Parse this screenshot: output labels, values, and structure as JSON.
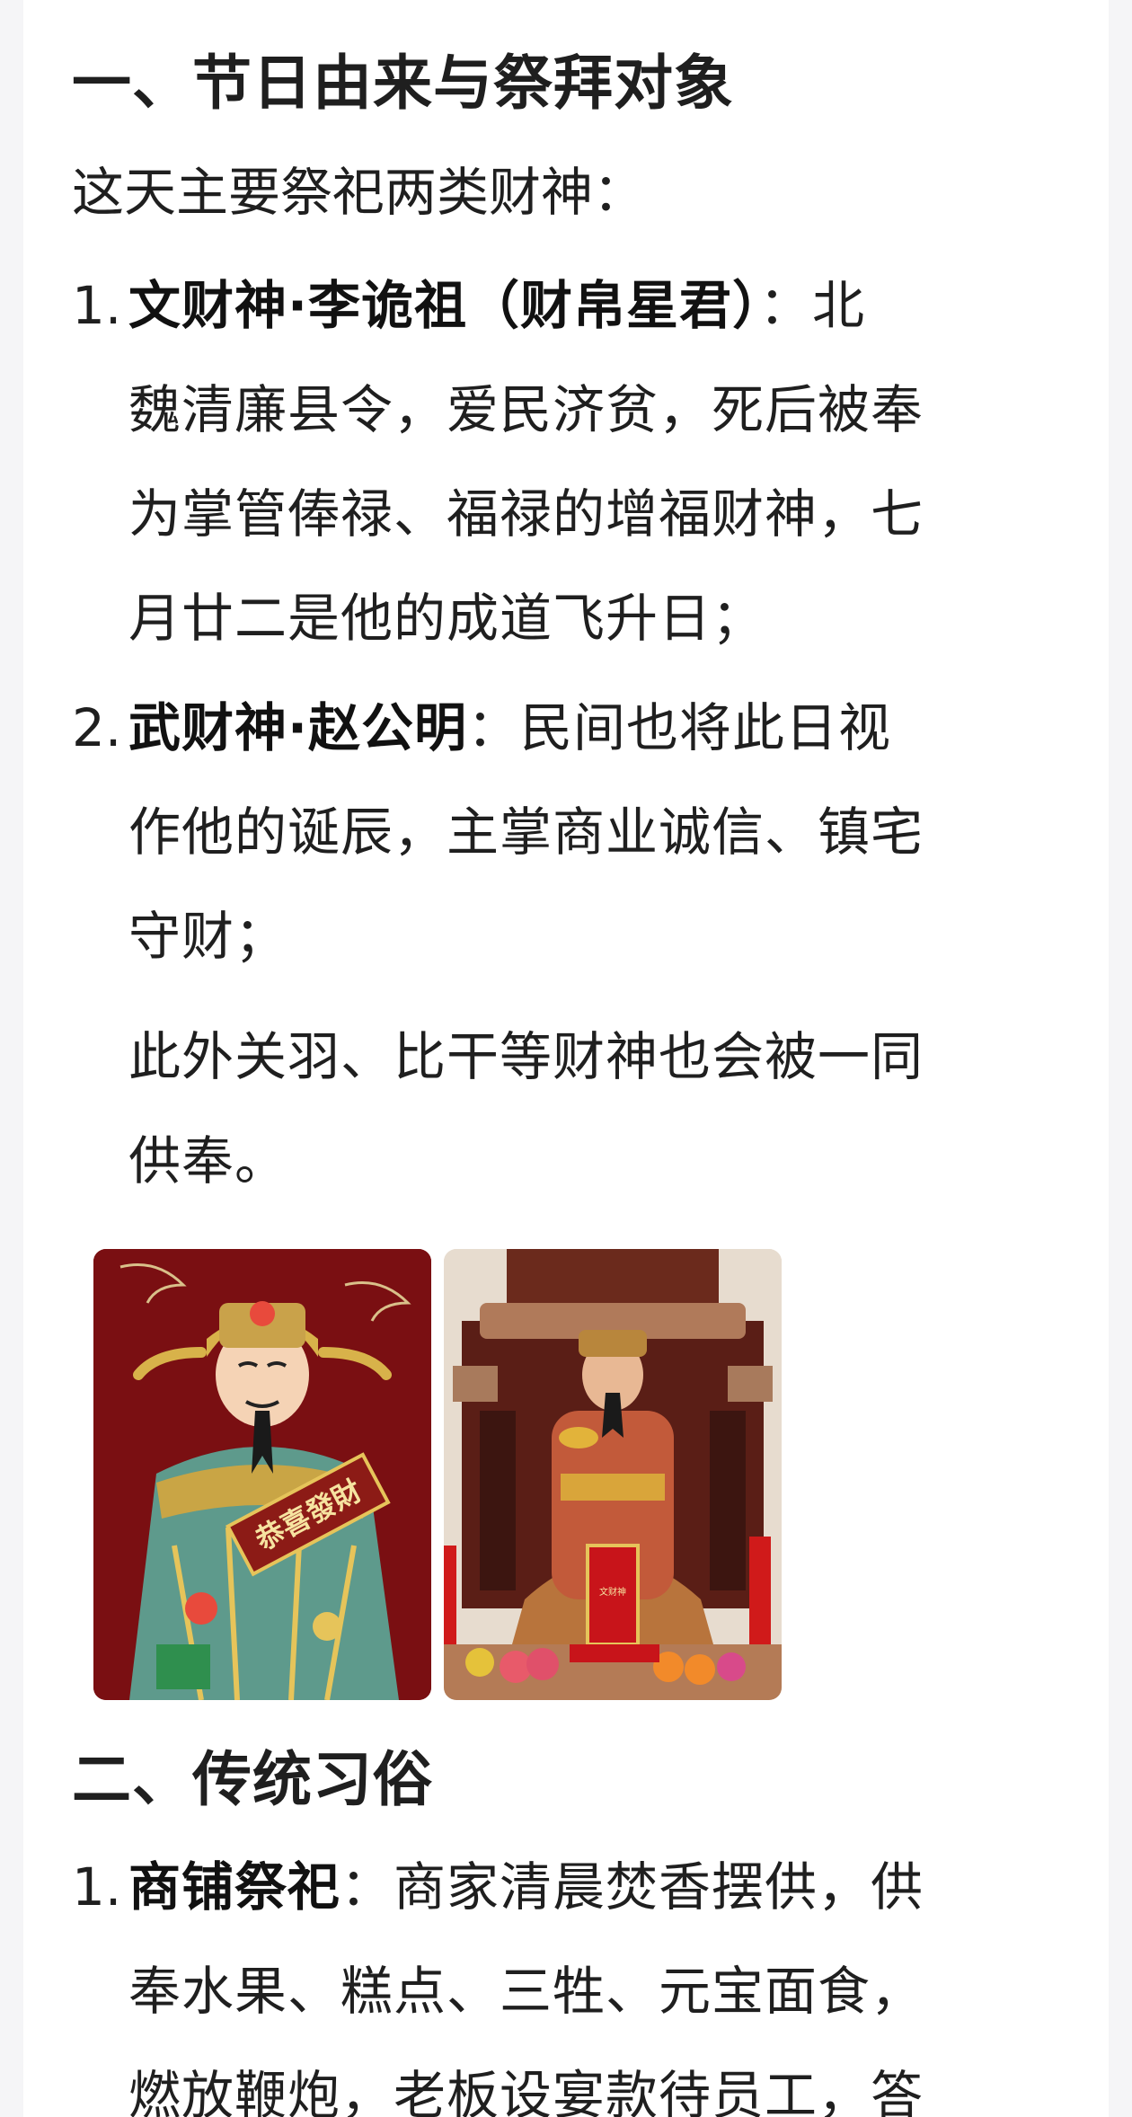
{
  "section1": {
    "heading": "一、节日由来与祭拜对象",
    "intro": "这天主要祭祀两类财神："
  },
  "items1": [
    {
      "number": "1.",
      "bold": "文财神·李诡祖（财帛星君）",
      "lines": [
        "：北",
        "魏清廉县令，爱民济贫，死后被奉",
        "为掌管俸禄、福禄的增福财神，七",
        "月廿二是他的成道飞升日；"
      ]
    },
    {
      "number": "2.",
      "bold": "武财神·赵公明",
      "lines": [
        "：民间也将此日视",
        "作他的诞辰，主掌商业诚信、镇宅",
        "守财；"
      ]
    }
  ],
  "note": {
    "lines": [
      "此外关羽、比干等财神也会被一同",
      "供奉。"
    ]
  },
  "images": {
    "image1_text": "恭喜發財",
    "image2_text": "文财神"
  },
  "section2": {
    "heading": "二、传统习俗"
  },
  "items2": [
    {
      "number": "1.",
      "bold": "商铺祭祀",
      "lines": [
        "：商家清晨焚香摆供，供",
        "奉水果、糕点、三牲、元宝面食，",
        "燃放鞭炮，老板设宴款待员工，答"
      ]
    }
  ]
}
